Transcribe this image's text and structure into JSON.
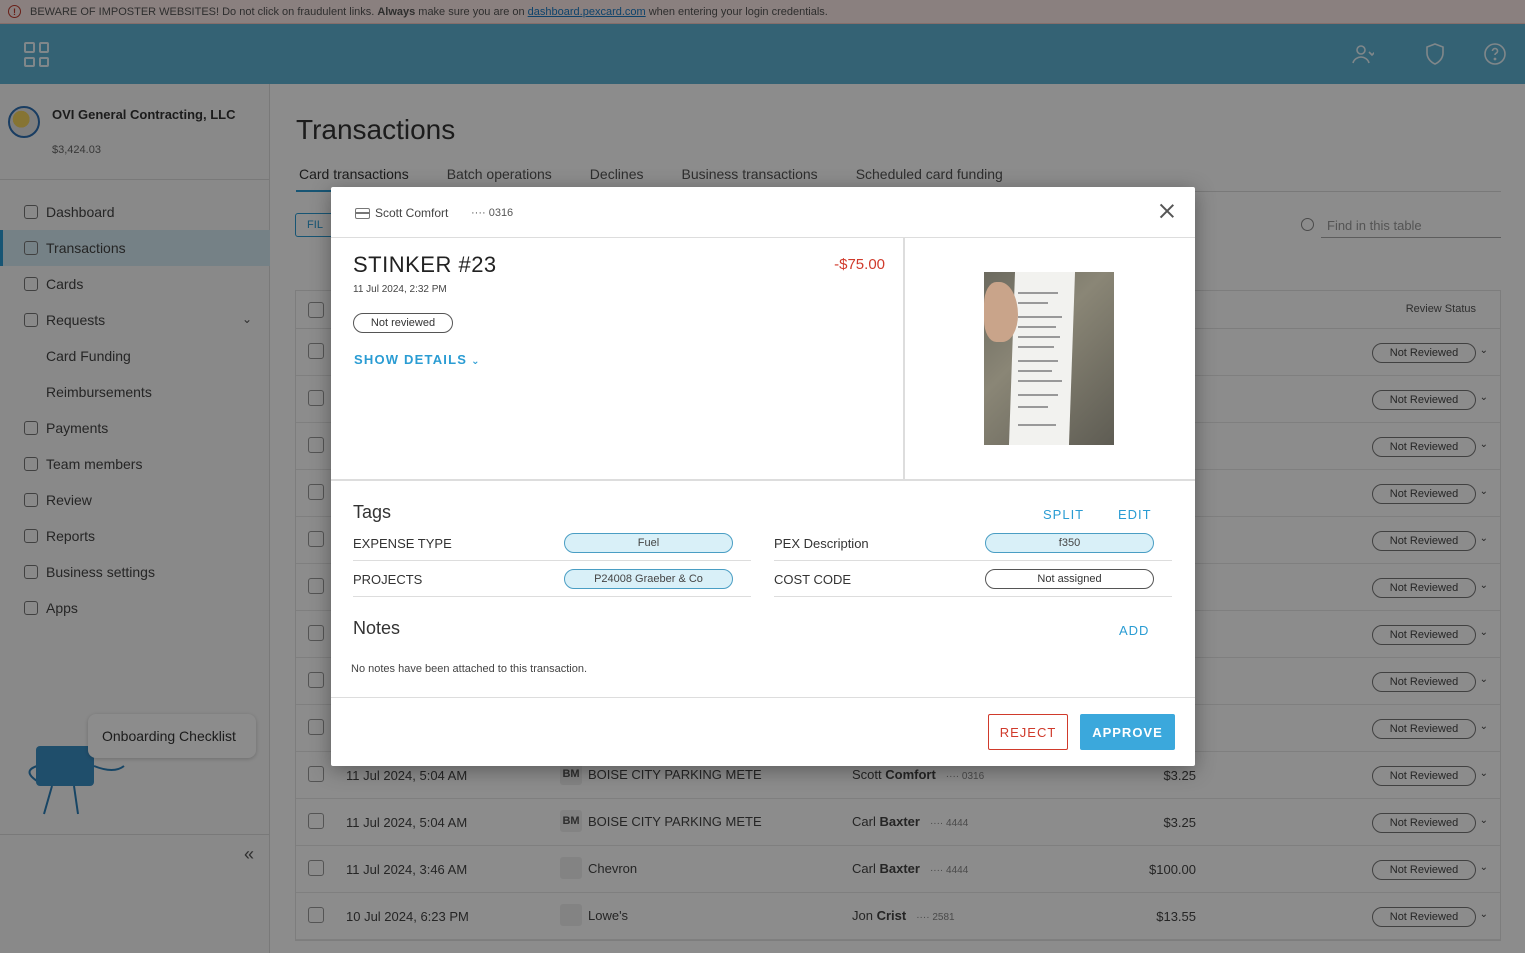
{
  "banner": {
    "prefix": "BEWARE OF IMPOSTER WEBSITES! Do not click on fraudulent links.",
    "bold": "Always",
    "middle": "make sure you are on",
    "link": "dashboard.pexcard.com",
    "suffix": "when entering your login credentials."
  },
  "org": {
    "name": "OVI General Contracting, LLC",
    "balance": "$3,424.03"
  },
  "nav": [
    {
      "label": "Dashboard"
    },
    {
      "label": "Transactions"
    },
    {
      "label": "Cards"
    },
    {
      "label": "Requests"
    },
    {
      "label": "Card Funding"
    },
    {
      "label": "Reimbursements"
    },
    {
      "label": "Payments"
    },
    {
      "label": "Team members"
    },
    {
      "label": "Review"
    },
    {
      "label": "Reports"
    },
    {
      "label": "Business settings"
    },
    {
      "label": "Apps"
    }
  ],
  "onboarding": "Onboarding Checklist",
  "page": {
    "title": "Transactions",
    "tabs": [
      "Card transactions",
      "Batch operations",
      "Declines",
      "Business transactions",
      "Scheduled card funding"
    ],
    "filter": "FIL",
    "search_placeholder": "Find in this table",
    "review_col": "Review Status"
  },
  "rows": [
    {
      "date": "",
      "merchant": "",
      "logo": "",
      "holder_first": "",
      "holder_last": "",
      "last4": "",
      "amount": "",
      "status": "Not Reviewed"
    },
    {
      "date": "",
      "merchant": "",
      "logo": "",
      "holder_first": "",
      "holder_last": "",
      "last4": "",
      "amount": "",
      "status": "Not Reviewed"
    },
    {
      "date": "",
      "merchant": "",
      "logo": "",
      "holder_first": "",
      "holder_last": "",
      "last4": "",
      "amount": "",
      "status": "Not Reviewed"
    },
    {
      "date": "",
      "merchant": "",
      "logo": "",
      "holder_first": "",
      "holder_last": "",
      "last4": "",
      "amount": "",
      "status": "Not Reviewed"
    },
    {
      "date": "",
      "merchant": "",
      "logo": "",
      "holder_first": "",
      "holder_last": "",
      "last4": "",
      "amount": "",
      "status": "Not Reviewed"
    },
    {
      "date": "",
      "merchant": "",
      "logo": "",
      "holder_first": "",
      "holder_last": "",
      "last4": "",
      "amount": "",
      "status": "Not Reviewed"
    },
    {
      "date": "",
      "merchant": "",
      "logo": "",
      "holder_first": "",
      "holder_last": "",
      "last4": "",
      "amount": "",
      "status": "Not Reviewed"
    },
    {
      "date": "",
      "merchant": "",
      "logo": "",
      "holder_first": "",
      "holder_last": "",
      "last4": "",
      "amount": "",
      "status": "Not Reviewed"
    },
    {
      "date": "",
      "merchant": "",
      "logo": "",
      "holder_first": "",
      "holder_last": "",
      "last4": "",
      "amount": "",
      "status": "Not Reviewed"
    },
    {
      "date": "11 Jul 2024, 5:04 AM",
      "merchant": "BOISE CITY PARKING METE",
      "logo": "BM",
      "holder_first": "Scott",
      "holder_last": "Comfort",
      "last4": "···· 0316",
      "amount": "$3.25",
      "status": "Not Reviewed"
    },
    {
      "date": "11 Jul 2024, 5:04 AM",
      "merchant": "BOISE CITY PARKING METE",
      "logo": "BM",
      "holder_first": "Carl",
      "holder_last": "Baxter",
      "last4": "···· 4444",
      "amount": "$3.25",
      "status": "Not Reviewed"
    },
    {
      "date": "11 Jul 2024, 3:46 AM",
      "merchant": "Chevron",
      "logo": "",
      "holder_first": "Carl",
      "holder_last": "Baxter",
      "last4": "···· 4444",
      "amount": "$100.00",
      "status": "Not Reviewed"
    },
    {
      "date": "10 Jul 2024, 6:23 PM",
      "merchant": "Lowe's",
      "logo": "",
      "holder_first": "Jon",
      "holder_last": "Crist",
      "last4": "···· 2581",
      "amount": "$13.55",
      "status": "Not Reviewed"
    }
  ],
  "modal": {
    "holder": "Scott Comfort",
    "last4": "···· 0316",
    "merchant": "STINKER #23",
    "amount": "-$75.00",
    "datetime": "11 Jul 2024, 2:32 PM",
    "status": "Not reviewed",
    "show_details": "SHOW DETAILS",
    "tags_title": "Tags",
    "split": "SPLIT",
    "edit": "EDIT",
    "tags": [
      {
        "label": "EXPENSE TYPE",
        "value": "Fuel"
      },
      {
        "label": "PEX Description",
        "value": "f350"
      },
      {
        "label": "PROJECTS",
        "value": "P24008 Graeber & Co"
      },
      {
        "label": "COST CODE",
        "value": "Not assigned"
      }
    ],
    "notes_title": "Notes",
    "add": "ADD",
    "no_notes": "No notes have been attached to this transaction.",
    "reject": "REJECT",
    "approve": "APPROVE"
  },
  "colors": {
    "accent": "#2a9cd3",
    "topbar": "#5fb3d3",
    "danger": "#d03a2b",
    "approve": "#3ba8dc"
  }
}
